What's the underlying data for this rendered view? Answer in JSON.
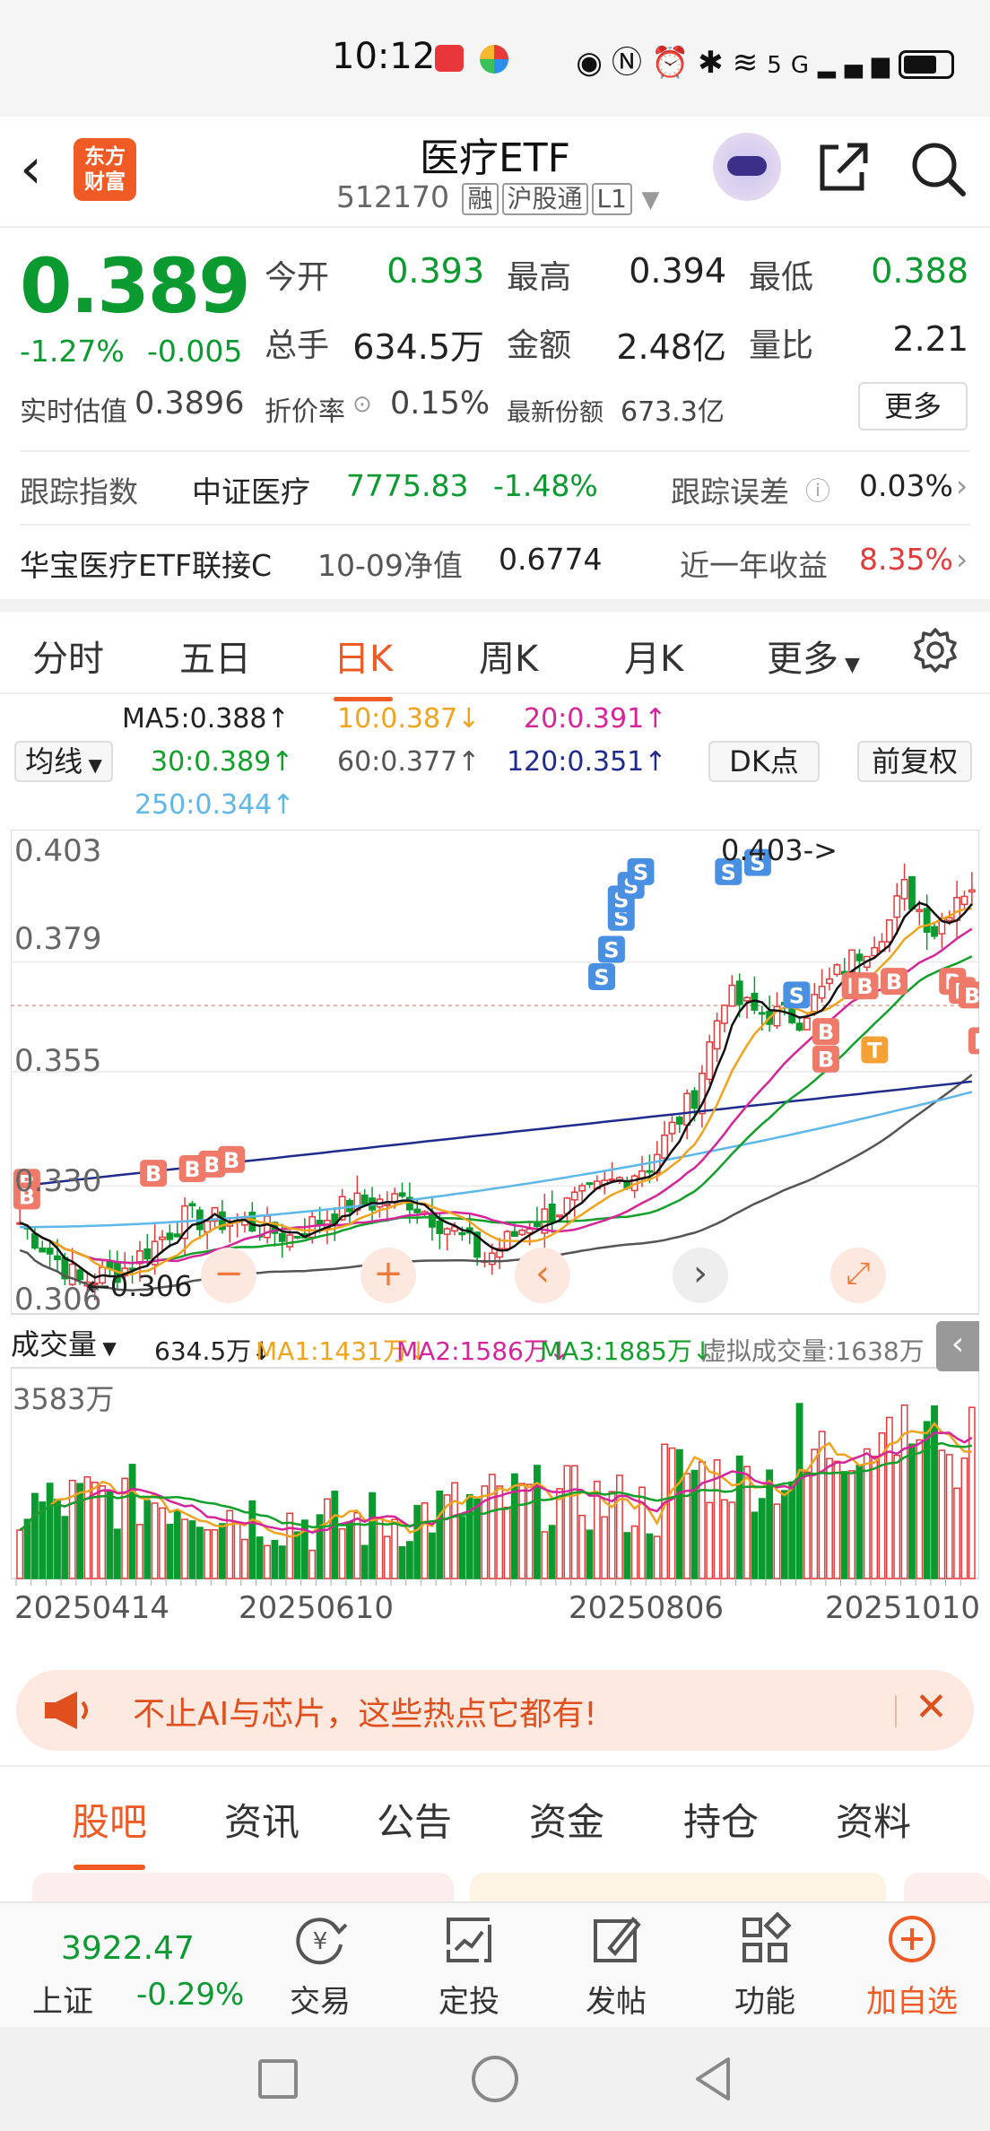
{
  "status_bar": {
    "time": "10:12",
    "network": "5G"
  },
  "header": {
    "logo_line1": "东方",
    "logo_line2": "财富",
    "title": "医疗ETF",
    "code": "512170",
    "tags": [
      "融",
      "沪股通",
      "L1"
    ]
  },
  "quote": {
    "price": "0.389",
    "change_pct": "-1.27%",
    "change": "-0.005",
    "open_label": "今开",
    "open": "0.393",
    "high_label": "最高",
    "high": "0.394",
    "low_label": "最低",
    "low": "0.388",
    "volume_label": "总手",
    "volume": "634.5万",
    "amount_label": "金额",
    "amount": "2.48亿",
    "vol_ratio_label": "量比",
    "vol_ratio": "2.21",
    "iopv_label": "实时估值",
    "iopv": "0.3896",
    "discount_label": "折价率",
    "discount": "0.15%",
    "shares_label": "最新份额",
    "shares": "673.3亿",
    "more": "更多"
  },
  "tracking": {
    "label": "跟踪指数",
    "index_name": "中证医疗",
    "index_value": "7775.83",
    "index_change": "-1.48%",
    "error_label": "跟踪误差",
    "error_value": "0.03%"
  },
  "linked_fund": {
    "name": "华宝医疗ETF联接C",
    "nav_label": "10-09净值",
    "nav": "0.6774",
    "year_label": "近一年收益",
    "year_return": "8.35%"
  },
  "kline_tabs": [
    "分时",
    "五日",
    "日K",
    "周K",
    "月K",
    "更多"
  ],
  "ma_legend": {
    "selector": "均线",
    "ma5": "MA5:0.388",
    "ma10": "10:0.387",
    "ma20": "20:0.391",
    "ma30": "30:0.389",
    "ma60": "60:0.377",
    "ma120": "120:0.351",
    "ma250": "250:0.344",
    "dk_button": "DK点",
    "adjust_button": "前复权"
  },
  "chart_data": {
    "type": "candlestick",
    "y_ticks": [
      "0.403",
      "0.379",
      "0.355",
      "0.330",
      "0.306"
    ],
    "price_high_label": "0.403->",
    "price_low_label": "0.306",
    "x_ticks": [
      "20250414",
      "20250610",
      "20250806",
      "20251010"
    ],
    "signals": [
      "B",
      "S",
      "T"
    ],
    "volume_max_label": "3583万",
    "colors": {
      "up": "#e23b3b",
      "down": "#0a9a2f",
      "ma5": "#111111",
      "ma10": "#f0a31c",
      "ma20": "#d6259b",
      "ma30": "#11a02a",
      "ma60": "#555555",
      "ma120": "#1f2c8e",
      "ma250": "#5db7ea"
    }
  },
  "volume_legend": {
    "selector": "成交量",
    "vol": "634.5万",
    "ma1": "MA1:1431万",
    "ma2": "MA2:1586万",
    "ma3": "MA3:1885万",
    "virtual": "虚拟成交量:1638万"
  },
  "banner": {
    "text": "不止AI与芯片，这些热点它都有!"
  },
  "bottom_tabs": [
    "股吧",
    "资讯",
    "公告",
    "资金",
    "持仓",
    "资料"
  ],
  "toolbar": {
    "index_value": "3922.47",
    "index_name": "上证",
    "index_change": "-0.29%",
    "buttons": [
      "交易",
      "定投",
      "发帖",
      "功能",
      "加自选"
    ]
  }
}
